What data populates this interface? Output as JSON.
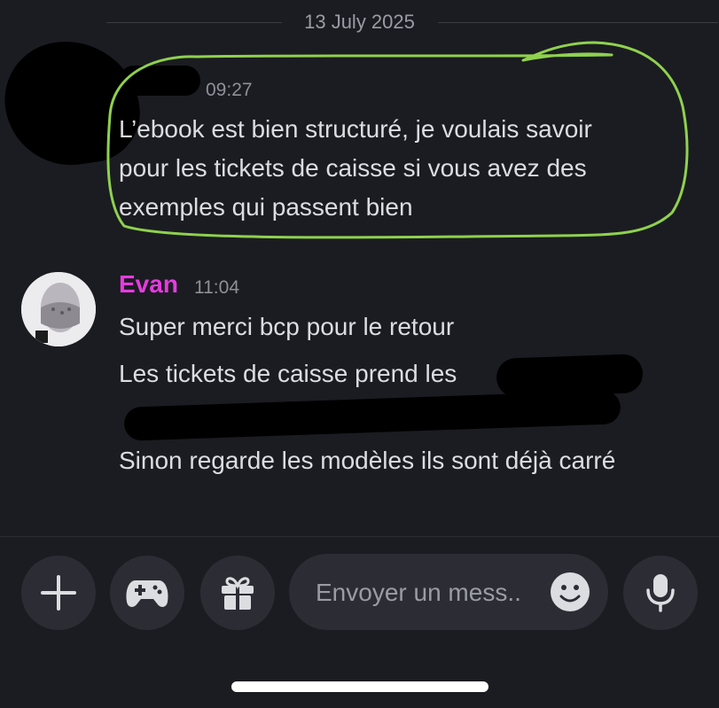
{
  "date_divider": "13 July 2025",
  "messages": [
    {
      "time": "09:27",
      "lines": [
        "L’ebook est bien structuré, je voulais savoir",
        "pour les tickets de caisse si vous avez des",
        "exemples qui passent bien"
      ]
    },
    {
      "author": "Evan",
      "time": "11:04",
      "lines": [
        "Super merci bcp pour le retour",
        "Les tickets de caisse prend les",
        "Sinon regarde les modèles ils sont déjà carré"
      ]
    }
  ],
  "composer": {
    "placeholder": "Envoyer un mess..",
    "buttons": [
      "plus-icon",
      "gamepad-icon",
      "gift-icon",
      "emoji-icon",
      "microphone-icon"
    ]
  },
  "colors": {
    "background": "#1b1c21",
    "author_name": "#e63be0",
    "highlight_stroke": "#8fd14f",
    "button_bg": "#2c2d34"
  }
}
